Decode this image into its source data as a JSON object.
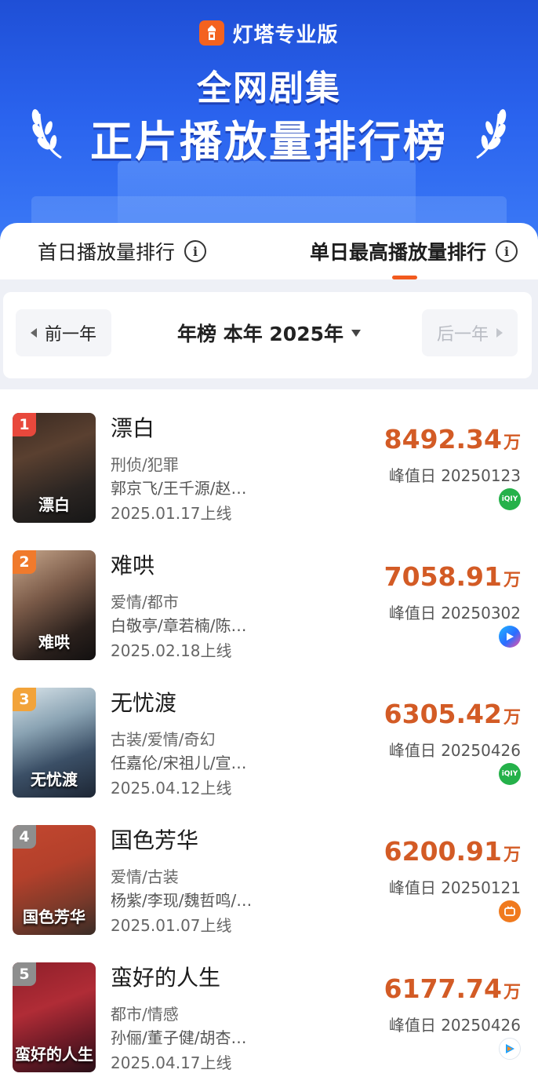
{
  "header": {
    "brand": "灯塔专业版",
    "title_line1": "全网剧集",
    "title_line2": "正片播放量排行榜"
  },
  "tabs": [
    {
      "label": "首日播放量排行"
    },
    {
      "label": "单日最高播放量排行",
      "active": true
    }
  ],
  "year_nav": {
    "prev_label": "前一年",
    "next_label": "后一年",
    "current": "年榜 本年 2025年"
  },
  "colors": {
    "accent": "#f25a1e",
    "value": "#d35b25",
    "banner": "#2a63ee",
    "rank1": "#e8483c",
    "rank2": "#f07a2c",
    "rank3": "#f2a33a",
    "rank_other": "#8e8e8e"
  },
  "items": [
    {
      "rank": "1",
      "title": "漂白",
      "genre": "刑侦/犯罪",
      "cast": "郭京飞/王千源/赵…",
      "release": "2025.01.17上线",
      "value": "8492.34",
      "unit": "万",
      "peak": "峰值日 20250123",
      "platform": "iqiyi-icon",
      "poster_text": "漂白"
    },
    {
      "rank": "2",
      "title": "难哄",
      "genre": "爱情/都市",
      "cast": "白敬亭/章若楠/陈…",
      "release": "2025.02.18上线",
      "value": "7058.91",
      "unit": "万",
      "peak": "峰值日 20250302",
      "platform": "youku-icon",
      "poster_text": "难哄"
    },
    {
      "rank": "3",
      "title": "无忧渡",
      "genre": "古装/爱情/奇幻",
      "cast": "任嘉伦/宋祖儿/宣…",
      "release": "2025.04.12上线",
      "value": "6305.42",
      "unit": "万",
      "peak": "峰值日 20250426",
      "platform": "iqiyi-icon",
      "poster_text": "无忧渡"
    },
    {
      "rank": "4",
      "title": "国色芳华",
      "genre": "爱情/古装",
      "cast": "杨紫/李现/魏哲鸣/…",
      "release": "2025.01.07上线",
      "value": "6200.91",
      "unit": "万",
      "peak": "峰值日 20250121",
      "platform": "mgtv-icon",
      "poster_text": "国色芳华"
    },
    {
      "rank": "5",
      "title": "蛮好的人生",
      "genre": "都市/情感",
      "cast": "孙俪/董子健/胡杏…",
      "release": "2025.04.17上线",
      "value": "6177.74",
      "unit": "万",
      "peak": "峰值日 20250426",
      "platform": "tencent-icon",
      "poster_text": "蛮好的人生"
    }
  ]
}
